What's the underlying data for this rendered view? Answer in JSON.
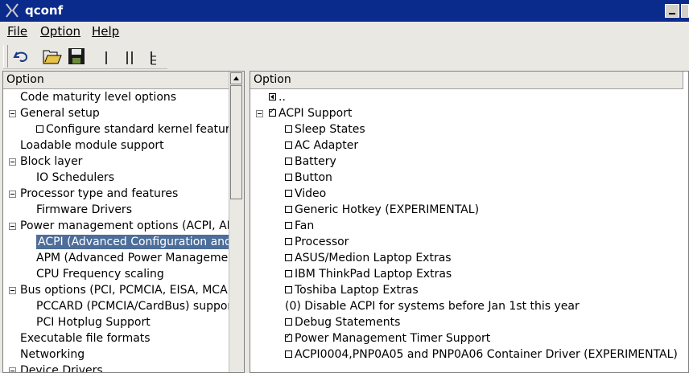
{
  "window": {
    "title": "qconf"
  },
  "menu": [
    {
      "label": "File"
    },
    {
      "label": "Option"
    },
    {
      "label": "Help"
    }
  ],
  "left": {
    "header": "Option",
    "items": [
      {
        "label": "Code maturity level options",
        "level": 0,
        "expand": false,
        "checkbox": false
      },
      {
        "label": "General setup",
        "level": 0,
        "expand": true,
        "checkbox": false
      },
      {
        "label": "Configure standard kernel features (for small systems)",
        "level": 1,
        "expand": false,
        "checkbox": true
      },
      {
        "label": "Loadable module support",
        "level": 0,
        "expand": false,
        "checkbox": false
      },
      {
        "label": "Block layer",
        "level": 0,
        "expand": true,
        "checkbox": false
      },
      {
        "label": "IO Schedulers",
        "level": 1,
        "expand": false,
        "checkbox": false
      },
      {
        "label": "Processor type and features",
        "level": 0,
        "expand": true,
        "checkbox": false
      },
      {
        "label": "Firmware Drivers",
        "level": 1,
        "expand": false,
        "checkbox": false
      },
      {
        "label": "Power management options (ACPI, APM)",
        "level": 0,
        "expand": true,
        "checkbox": false
      },
      {
        "label": "ACPI (Advanced Configuration and Power Interface) Support",
        "level": 1,
        "expand": false,
        "checkbox": false,
        "selected": true
      },
      {
        "label": "APM (Advanced Power Management) BIOS Support",
        "level": 1,
        "expand": false,
        "checkbox": false
      },
      {
        "label": "CPU Frequency scaling",
        "level": 1,
        "expand": false,
        "checkbox": false
      },
      {
        "label": "Bus options (PCI, PCMCIA, EISA, MCA, ISA)",
        "level": 0,
        "expand": true,
        "checkbox": false
      },
      {
        "label": "PCCARD (PCMCIA/CardBus) support",
        "level": 1,
        "expand": false,
        "checkbox": false
      },
      {
        "label": "PCI Hotplug Support",
        "level": 1,
        "expand": false,
        "checkbox": false
      },
      {
        "label": "Executable file formats",
        "level": 0,
        "expand": false,
        "checkbox": false
      },
      {
        "label": "Networking",
        "level": 0,
        "expand": false,
        "checkbox": false
      },
      {
        "label": "Device Drivers",
        "level": 0,
        "expand": true,
        "checkbox": false
      }
    ]
  },
  "right": {
    "header": "Option",
    "items": [
      {
        "label": "..",
        "kind": "back"
      },
      {
        "label": "ACPI Support",
        "kind": "parent",
        "checked": true
      },
      {
        "label": "Sleep States",
        "kind": "child",
        "checked": false
      },
      {
        "label": "AC Adapter",
        "kind": "child",
        "checked": false
      },
      {
        "label": "Battery",
        "kind": "child",
        "checked": false
      },
      {
        "label": "Button",
        "kind": "child",
        "checked": false
      },
      {
        "label": "Video",
        "kind": "child",
        "checked": false
      },
      {
        "label": "Generic Hotkey (EXPERIMENTAL)",
        "kind": "child",
        "checked": false
      },
      {
        "label": "Fan",
        "kind": "child",
        "checked": false
      },
      {
        "label": "Processor",
        "kind": "child",
        "checked": false
      },
      {
        "label": "ASUS/Medion Laptop Extras",
        "kind": "child",
        "checked": false
      },
      {
        "label": "IBM ThinkPad Laptop Extras",
        "kind": "child",
        "checked": false
      },
      {
        "label": "Toshiba Laptop Extras",
        "kind": "child",
        "checked": false
      },
      {
        "label": "(0) Disable ACPI for systems before Jan 1st this year",
        "kind": "value"
      },
      {
        "label": "Debug Statements",
        "kind": "child",
        "checked": false
      },
      {
        "label": "Power Management Timer Support",
        "kind": "child",
        "checked": true
      },
      {
        "label": "ACPI0004,PNP0A05 and PNP0A06 Container Driver (EXPERIMENTAL)",
        "kind": "child",
        "checked": false
      }
    ]
  }
}
